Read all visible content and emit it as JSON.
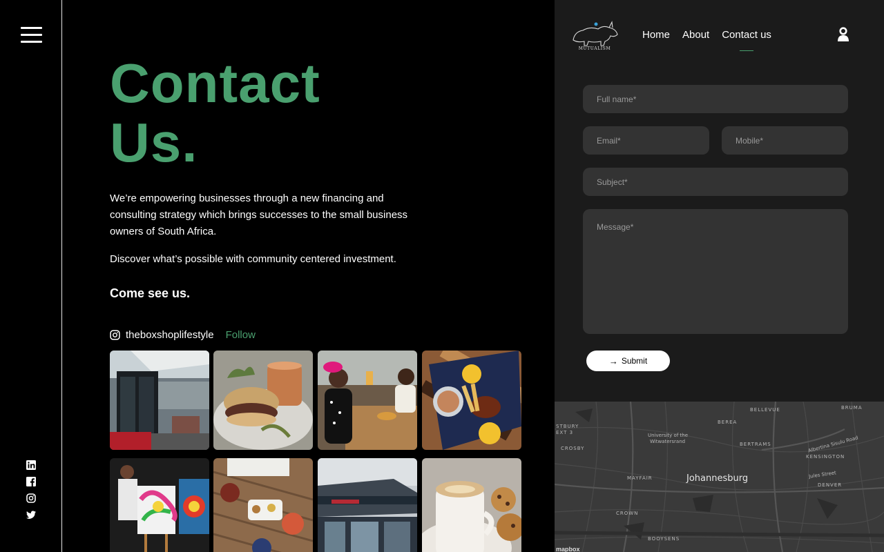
{
  "nav": {
    "items": [
      {
        "label": "Home"
      },
      {
        "label": "About"
      },
      {
        "label": "Contact us",
        "active": true
      }
    ],
    "logo_text": "MUTUALISM"
  },
  "hero": {
    "title_line1": "Contact",
    "title_line2": "Us.",
    "accent_color": "#4aa06f",
    "intro": "We’re empowering businesses through a new financing and consulting strategy which brings successes to the small business owners of South Africa.",
    "intro2": "Discover what’s possible with community centered investment.",
    "come_see": "Come see us."
  },
  "instagram": {
    "handle": "theboxshoplifestyle",
    "follow_label": "Follow",
    "tiles": [
      {
        "name": "shop-entrance"
      },
      {
        "name": "burger-plate"
      },
      {
        "name": "friends-toasting"
      },
      {
        "name": "chicken-platter"
      },
      {
        "name": "artist-painting"
      },
      {
        "name": "table-overhead"
      },
      {
        "name": "container-building"
      },
      {
        "name": "coffee-cookies"
      }
    ]
  },
  "form": {
    "full_name_placeholder": "Full name*",
    "email_placeholder": "Email*",
    "mobile_placeholder": "Mobile*",
    "subject_placeholder": "Subject*",
    "message_placeholder": "Message*",
    "submit_label": "Submit"
  },
  "map": {
    "city": "Johannesburg",
    "labels": [
      "BELLEVUE",
      "BRUMA",
      "BEREA",
      "STBURY",
      "EXT 3",
      "University of the",
      "Witwatersrand",
      "BERTRAMS",
      "Albertina Sisulu Road",
      "KENSINGTON",
      "CROSBY",
      "MAYFAIR",
      "Jules Street",
      "DENVER",
      "CROWN",
      "BOOYSENS"
    ],
    "attribution": "mapbox"
  },
  "socials": [
    "linkedin-icon",
    "facebook-icon",
    "instagram-icon",
    "twitter-icon"
  ]
}
